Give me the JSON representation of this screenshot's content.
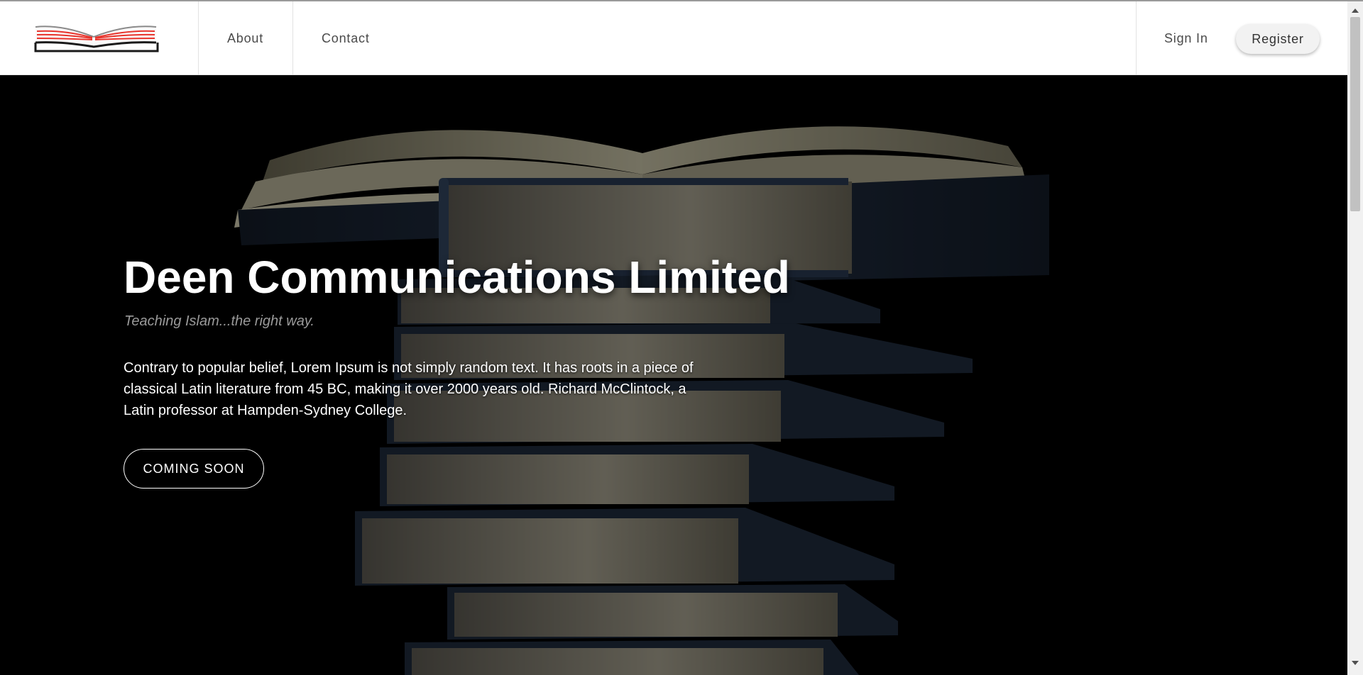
{
  "nav": {
    "links": [
      "About",
      "Contact"
    ],
    "sign_in": "Sign In",
    "register": "Register"
  },
  "hero": {
    "title": "Deen Communications Limited",
    "tagline": "Teaching Islam...the right way.",
    "body": "Contrary to popular belief, Lorem Ipsum is not simply random text. It has roots in a piece of classical Latin literature from 45 BC, making it over 2000 years old. Richard McClintock, a Latin professor at Hampden-Sydney College.",
    "cta": "COMING SOON"
  },
  "colors": {
    "navbar_bg": "#ffffff",
    "hero_bg": "#000000",
    "logo_accent": "#e8342c",
    "book_cover": "#1e2a3c",
    "book_pages": "#cdc8b4"
  },
  "icons": {
    "logo": "open-book-logo",
    "scroll_up": "arrow-up-icon",
    "scroll_down": "arrow-down-icon"
  }
}
